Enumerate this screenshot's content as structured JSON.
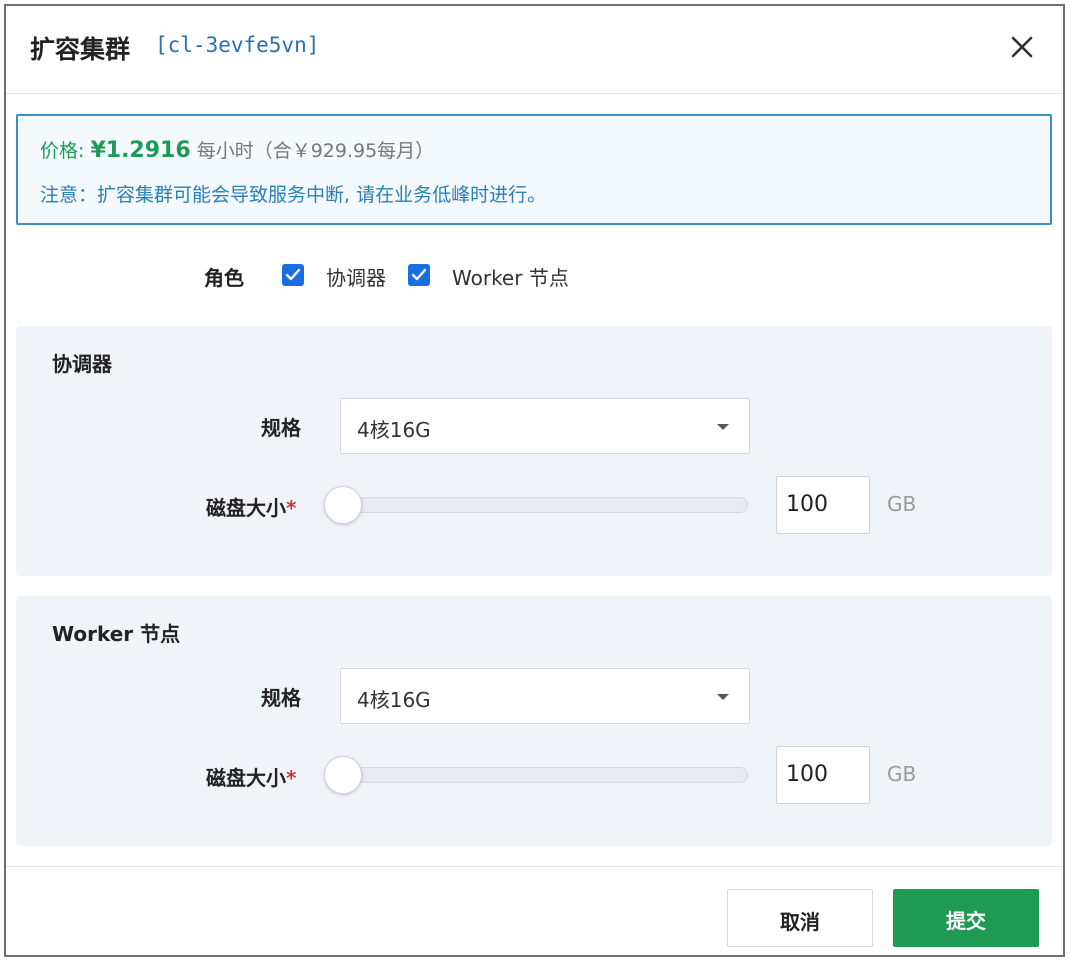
{
  "header": {
    "title": "扩容集群",
    "cluster_id": "[cl-3evfe5vn]",
    "close_icon": "close-icon"
  },
  "notice": {
    "price_label": "价格: ",
    "price_value": "¥1.2916",
    "price_unit": "每小时（合￥929.95每月）",
    "warning": "注意：扩容集群可能会导致服务中断, 请在业务低峰时进行。"
  },
  "role": {
    "label": "角色",
    "options": [
      {
        "label": "协调器",
        "checked": true
      },
      {
        "label": "Worker 节点",
        "checked": true
      }
    ]
  },
  "sections": [
    {
      "title": "协调器",
      "spec_label": "规格",
      "spec_value": "4核16G",
      "disk_label": "磁盘大小",
      "required_mark": "*",
      "disk_value": "100",
      "disk_unit": "GB"
    },
    {
      "title": "Worker 节点",
      "spec_label": "规格",
      "spec_value": "4核16G",
      "disk_label": "磁盘大小",
      "required_mark": "*",
      "disk_value": "100",
      "disk_unit": "GB"
    }
  ],
  "footer": {
    "cancel_label": "取消",
    "submit_label": "提交"
  },
  "colors": {
    "accent_green": "#1f9a55",
    "info_blue": "#2b7fb8",
    "checkbox_blue": "#1a6fe0"
  }
}
